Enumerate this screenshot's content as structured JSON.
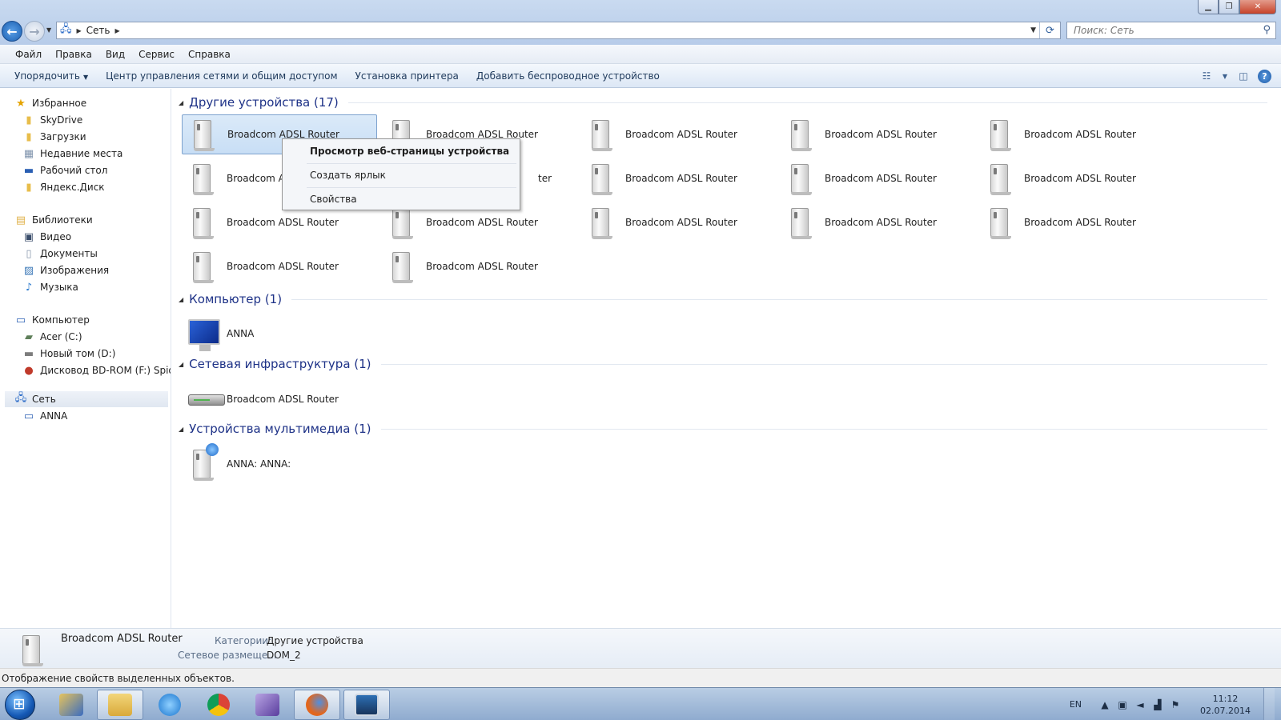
{
  "address": {
    "crumb": "Сеть",
    "search_placeholder": "Поиск: Сеть"
  },
  "menu": [
    "Файл",
    "Правка",
    "Вид",
    "Сервис",
    "Справка"
  ],
  "commands": {
    "organize": "Упорядочить",
    "network_center": "Центр управления сетями и общим доступом",
    "add_printer": "Установка принтера",
    "add_wireless": "Добавить беспроводное устройство"
  },
  "sidebar": {
    "favorites": "Избранное",
    "fav_items": [
      "SkyDrive",
      "Загрузки",
      "Недавние места",
      "Рабочий стол",
      "Яндекс.Диск"
    ],
    "libraries": "Библиотеки",
    "lib_items": [
      "Видео",
      "Документы",
      "Изображения",
      "Музыка"
    ],
    "computer": "Компьютер",
    "comp_items": [
      "Acer (C:)",
      "Новый том (D:)",
      "Дисковод BD-ROM (F:) Spider-"
    ],
    "network": "Сеть",
    "net_items": [
      "ANNA"
    ]
  },
  "groups": {
    "other": "Другие устройства (17)",
    "computer": "Компьютер (1)",
    "infra": "Сетевая инфраструктура (1)",
    "media": "Устройства мультимедиа (1)"
  },
  "device_label": "Broadcom ADSL Router",
  "device_label_clip_1": "Broadcom A",
  "device_label_clip_2": "ter",
  "computer_item": "ANNA",
  "infra_item": "Broadcom ADSL Router",
  "media_item": "ANNA: ANNA:",
  "context_menu": {
    "view_page": "Просмотр веб-страницы устройства",
    "create_shortcut": "Создать ярлык",
    "properties": "Свойства"
  },
  "details": {
    "name": "Broadcom ADSL Router",
    "category_label": "Категории:",
    "category_value": "Другие устройства",
    "location_label": "Сетевое размеще...",
    "location_value": "DOM_2"
  },
  "status": "Отображение свойств выделенных объектов.",
  "tray": {
    "lang": "EN",
    "time": "11:12",
    "date": "02.07.2014"
  }
}
